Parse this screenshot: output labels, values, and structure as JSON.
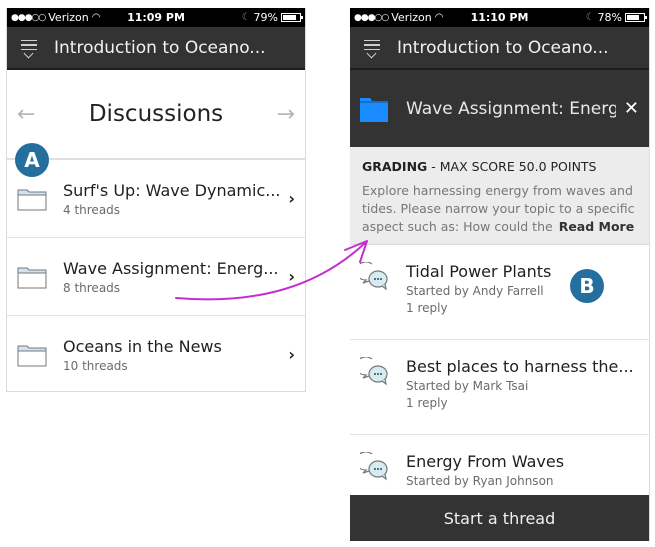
{
  "left_screen": {
    "status_bar": {
      "signal": "●●●○○",
      "carrier": "Verizon",
      "wifi_icon": "wifi-icon",
      "time": "11:09 PM",
      "battery": "79%",
      "battery_level": 0.79
    },
    "header": {
      "title": "Introduction to Oceano..."
    },
    "nav": {
      "title": "Discussions",
      "prev_icon": "←",
      "next_icon": "→"
    },
    "forums": [
      {
        "title": "Surf's Up: Wave Dynamic...",
        "threads": "4 threads"
      },
      {
        "title": "Wave Assignment: Energ...",
        "threads": "8 threads"
      },
      {
        "title": "Oceans in the News",
        "threads": "10 threads"
      }
    ],
    "chevron": "›"
  },
  "right_screen": {
    "status_bar": {
      "signal": "●●●○○",
      "carrier": "Verizon",
      "wifi_icon": "wifi-icon",
      "time": "11:10 PM",
      "battery": "78%",
      "battery_level": 0.78
    },
    "header": {
      "title": "Introduction to Oceano..."
    },
    "forum": {
      "title": "Wave Assignment: Energy",
      "close": "✕"
    },
    "grading": {
      "label": "GRADING",
      "detail": " - MAX SCORE 50.0  POINTS",
      "description": "Explore harnessing energy from waves and tides. Please narrow your topic to a specific aspect such as:   How could the",
      "read_more": "Read More"
    },
    "threads": [
      {
        "title": "Tidal Power Plants",
        "author": "Started by Andy Farrell",
        "replies": "1 reply"
      },
      {
        "title": "Best places to harness the...",
        "author": "Started by Mark Tsai",
        "replies": "1 reply"
      },
      {
        "title": "Energy From Waves",
        "author": "Started by Ryan Johnson",
        "replies": ""
      }
    ],
    "start_thread": "Start a thread"
  },
  "markers": {
    "a": "A",
    "b": "B"
  },
  "colors": {
    "marker": "#246f9e",
    "arrow": "#c42fd1",
    "header": "#333333",
    "folder_blue": "#1a8cff",
    "folder_light": "#cfe3f5"
  }
}
